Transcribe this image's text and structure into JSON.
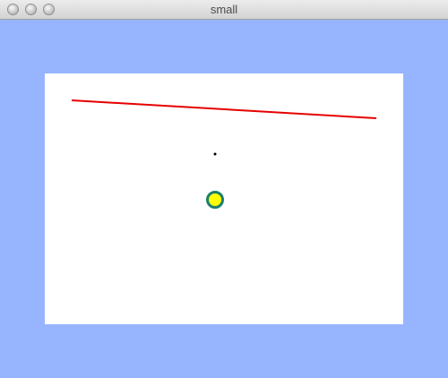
{
  "window": {
    "title": "small"
  },
  "colors": {
    "background": "#97b5ff",
    "canvas": "#ffffff",
    "line": "#e60000",
    "dot": "#000000",
    "circle_fill": "#ffff00",
    "circle_stroke": "#1a7f6e"
  },
  "icons": {
    "close": "close-icon",
    "minimize": "minimize-icon",
    "zoom": "zoom-icon"
  }
}
